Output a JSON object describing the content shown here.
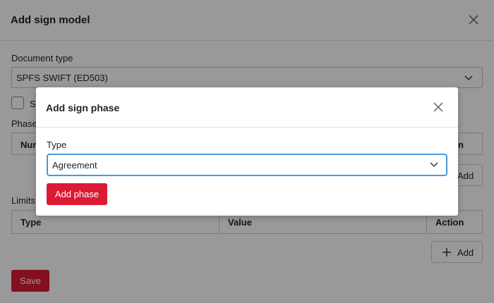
{
  "base": {
    "title": "Add sign model",
    "document_type_label": "Document type",
    "document_type_value": "SPFS SWIFT (ED503)",
    "checkbox_label": "S",
    "phases_label": "Phases",
    "phases_table": {
      "headers": [
        "Num",
        "n"
      ]
    },
    "phases_add_label": "Add",
    "limits_label": "Limits",
    "limits_table": {
      "headers": [
        "Type",
        "Value",
        "Action"
      ]
    },
    "limits_add_label": "Add",
    "save_label": "Save"
  },
  "modal": {
    "title": "Add sign phase",
    "type_label": "Type",
    "type_value": "Agreement",
    "add_phase_label": "Add phase"
  },
  "colors": {
    "primary": "#dc1a33",
    "focus_border": "#4a98db",
    "overlay": "rgba(0,0,0,0.40)"
  },
  "icons": {
    "close": "close-icon",
    "chevron": "chevron-down-icon",
    "plus": "plus-icon"
  }
}
